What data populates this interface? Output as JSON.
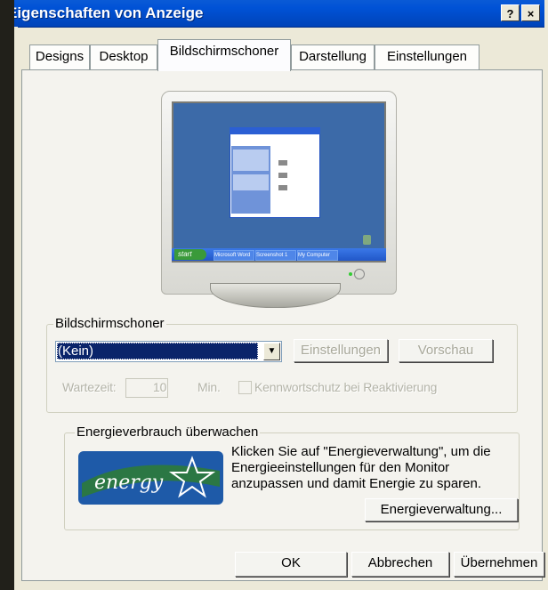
{
  "window": {
    "title": "Eigenschaften von Anzeige",
    "help_glyph": "?",
    "close_glyph": "×"
  },
  "tabs": [
    {
      "label": "Designs"
    },
    {
      "label": "Desktop"
    },
    {
      "label": "Bildschirmschoner"
    },
    {
      "label": "Darstellung"
    },
    {
      "label": "Einstellungen"
    }
  ],
  "active_tab": 2,
  "preview": {
    "taskbar_items": [
      "Microsoft Word",
      "Screenshot 1",
      "My Computer"
    ]
  },
  "screensaver": {
    "group_label": "Bildschirmschoner",
    "selected": "(Kein)",
    "settings_button": "Einstellungen",
    "preview_button": "Vorschau",
    "wait_label": "Wartezeit:",
    "wait_value": "10",
    "wait_unit": "Min.",
    "password_label": "Kennwortschutz bei Reaktivierung"
  },
  "energy": {
    "group_label": "Energieverbrauch überwachen",
    "description": "Klicken Sie auf \"Energieverwaltung\", um die Energieeinstellungen für den Monitor anzupassen und damit Energie zu sparen.",
    "line1": "Klicken Sie auf \"Energieverwaltung\", um die",
    "line2": "Energieeinstellungen für den Monitor",
    "line3": "anzupassen und damit Energie zu sparen.",
    "button": "Energieverwaltung...",
    "logo_text": "energy"
  },
  "footer": {
    "ok": "OK",
    "cancel": "Abbrechen",
    "apply": "Übernehmen"
  },
  "colors": {
    "titlebar": "#0052d6",
    "dialog_bg": "#ece9d8",
    "selection": "#0a246a"
  }
}
